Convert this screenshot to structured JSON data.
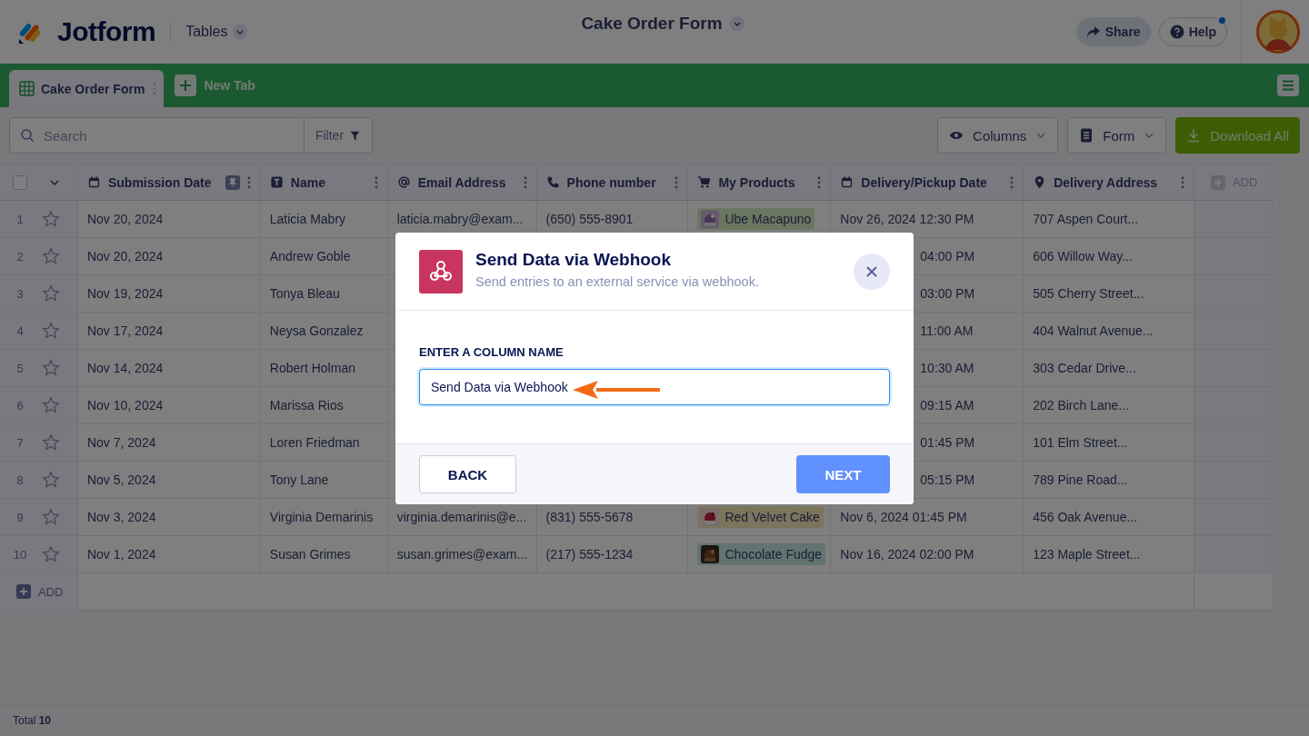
{
  "header": {
    "logo": "Jotform",
    "section": "Tables",
    "title": "Cake Order Form",
    "share": "Share",
    "help": "Help",
    "help_notification": true
  },
  "tabs": [
    {
      "label": "Cake Order Form",
      "selected": true
    }
  ],
  "new_tab": "New Tab",
  "toolbar": {
    "search_placeholder": "Search",
    "filter": "Filter",
    "columns": "Columns",
    "form": "Form",
    "download": "Download All"
  },
  "table": {
    "select_all_checked": false,
    "columns": [
      {
        "label": "Submission Date",
        "kind": "date",
        "pinned": true
      },
      {
        "label": "Name",
        "kind": "text",
        "pinned": false
      },
      {
        "label": "Email Address",
        "kind": "email",
        "pinned": false
      },
      {
        "label": "Phone number",
        "kind": "phone",
        "pinned": false
      },
      {
        "label": "My Products",
        "kind": "cart",
        "pinned": false
      },
      {
        "label": "Delivery/Pickup Date",
        "kind": "date",
        "pinned": false
      },
      {
        "label": "Delivery Address",
        "kind": "location",
        "pinned": false
      }
    ],
    "add_column": "ADD",
    "rows": [
      {
        "number": "1",
        "starred": false,
        "submitted": "Nov 20, 2024",
        "name": "Laticia Mabry",
        "email": "laticia.mabry@exam...",
        "phone": "(650) 555-8901",
        "product": {
          "label": "Ube Macapuno",
          "color": "#6b7661"
        },
        "delivery": "Nov 26, 2024 12:30 PM",
        "address": "707 Aspen Court..."
      },
      {
        "number": "2",
        "starred": false,
        "submitted": "Nov 20, 2024",
        "name": "Andrew Goble",
        "delivery_tail": "04:00 PM",
        "address": "606 Willow Way..."
      },
      {
        "number": "3",
        "starred": false,
        "submitted": "Nov 19, 2024",
        "name": "Tonya Bleau",
        "delivery_tail": "03:00 PM",
        "address": "505 Cherry Street..."
      },
      {
        "number": "4",
        "starred": false,
        "submitted": "Nov 17, 2024",
        "name": "Neysa Gonzalez",
        "delivery_tail": "11:00 AM",
        "address": "404 Walnut Avenue..."
      },
      {
        "number": "5",
        "starred": false,
        "submitted": "Nov 14, 2024",
        "name": "Robert Holman",
        "delivery_tail": "10:30 AM",
        "address": "303 Cedar Drive..."
      },
      {
        "number": "6",
        "starred": false,
        "submitted": "Nov 10, 2024",
        "name": "Marissa Rios",
        "delivery_tail": "09:15 AM",
        "address": "202 Birch Lane..."
      },
      {
        "number": "7",
        "starred": false,
        "submitted": "Nov 7, 2024",
        "name": "Loren Friedman",
        "delivery_tail": "01:45 PM",
        "address": "101 Elm Street..."
      },
      {
        "number": "8",
        "starred": false,
        "submitted": "Nov 5, 2024",
        "name": "Tony Lane",
        "delivery_tail": "05:15 PM",
        "address": "789 Pine Road..."
      },
      {
        "number": "9",
        "starred": false,
        "submitted": "Nov 3, 2024",
        "name": "Virginia Demarinis",
        "email": "virginia.demarinis@e...",
        "phone": "(831) 555-5678",
        "product": {
          "label": "Red Velvet Cake",
          "color": "#7a755c"
        },
        "delivery": "Nov 6, 2024 01:45 PM",
        "address": "456 Oak Avenue..."
      },
      {
        "number": "10",
        "starred": false,
        "submitted": "Nov 1, 2024",
        "name": "Susan Grimes",
        "email": "susan.grimes@exam...",
        "phone": "(217) 555-1234",
        "product": {
          "label": "Chocolate Fudge",
          "color": "#617470"
        },
        "delivery": "Nov 16, 2024 02:00 PM",
        "address": "123 Maple Street..."
      }
    ],
    "add_row": "ADD"
  },
  "footer": {
    "total": "Total **10**"
  },
  "dialog": {
    "title": "Send Data via Webhook",
    "subtitle": "Send entries to an external service via webhook.",
    "field_label": "ENTER A COLUMN NAME",
    "field_value": "Send Data via Webhook",
    "back": "BACK",
    "next": "NEXT"
  }
}
